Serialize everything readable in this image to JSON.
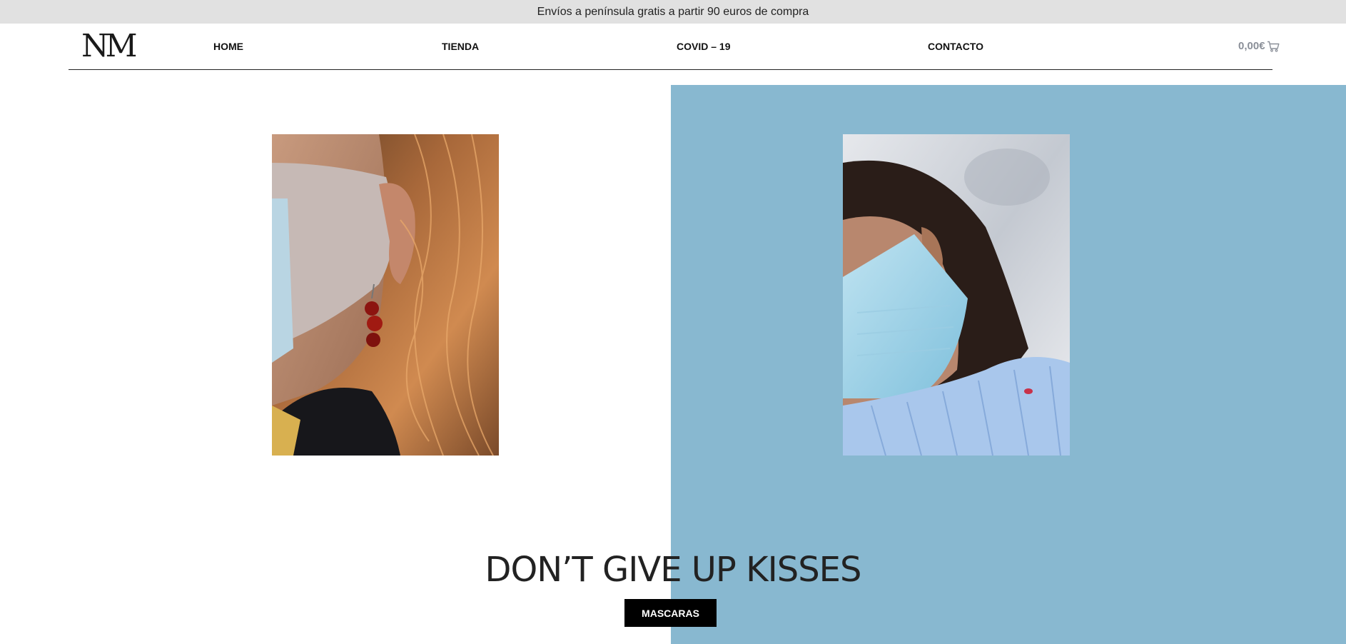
{
  "announcement": "Envíos a península gratis a partir 90 euros de compra",
  "logo": "NM",
  "nav": {
    "home": "HOME",
    "shop": "TIENDA",
    "covid": "COVID – 19",
    "contact": "CONTACTO"
  },
  "cart": {
    "total": "0,00€",
    "icon": "cart-icon"
  },
  "hero": {
    "headline": "DON’T GIVE UP KISSES",
    "cta": "MASCARAS"
  },
  "colors": {
    "accent_panel": "#88b8d0",
    "topbar": "#e1e1e1",
    "cta_bg": "#000000"
  }
}
